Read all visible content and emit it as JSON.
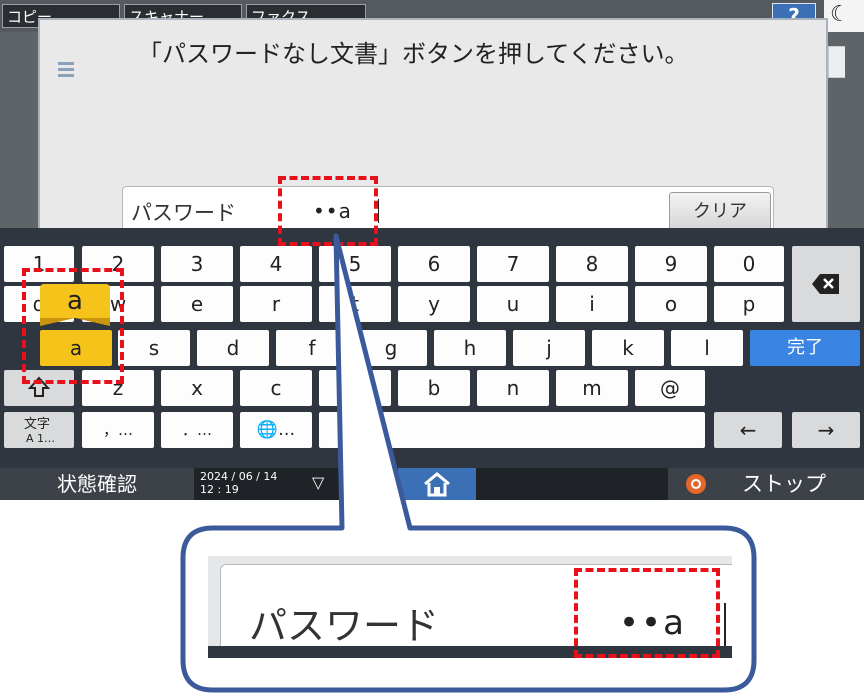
{
  "top_tabs": [
    {
      "label": "コピー"
    },
    {
      "label": "スキャナー"
    },
    {
      "label": "ファクス"
    }
  ],
  "help_button": {
    "label": "?"
  },
  "night_mode": {
    "icon": "moon-icon",
    "glyph": "☾"
  },
  "dialog": {
    "message": "「パスワードなし文書」ボタンを押してください。",
    "password_label": "パスワード",
    "password_value": "••a",
    "clear_label": "クリア"
  },
  "keyboard": {
    "row1": [
      "1",
      "2",
      "3",
      "4",
      "5",
      "6",
      "7",
      "8",
      "9",
      "0"
    ],
    "row2": [
      "q",
      "w",
      "e",
      "r",
      "t",
      "y",
      "u",
      "i",
      "o",
      "p"
    ],
    "row3": [
      "a",
      "s",
      "d",
      "f",
      "g",
      "h",
      "j",
      "k",
      "l"
    ],
    "row4": [
      "z",
      "x",
      "c",
      "v",
      "b",
      "n",
      "m",
      "@"
    ],
    "comma_key": "，…",
    "period_key": "．…",
    "globe_key": "🌐…",
    "mode_key": {
      "line1": "文字",
      "line2": "A 1…"
    },
    "done_label": "完了",
    "backspace_icon": "backspace-icon",
    "shift_icon": "shift-icon",
    "left_arrow": "←",
    "right_arrow": "→",
    "popup_char": "a"
  },
  "status_bar": {
    "status_label": "状態確認",
    "date": "2024 / 06 / 14",
    "time": "12 : 19",
    "down_glyph": "▽",
    "home_icon": "home-icon",
    "stop_label": "ストップ"
  },
  "callout": {
    "password_label": "パスワード",
    "password_value": "••a"
  },
  "colors": {
    "annotation_red": "#e8101a",
    "callout_border": "#3b5a9c",
    "done_blue": "#3a84e4",
    "highlight_yellow": "#f6c31a"
  }
}
